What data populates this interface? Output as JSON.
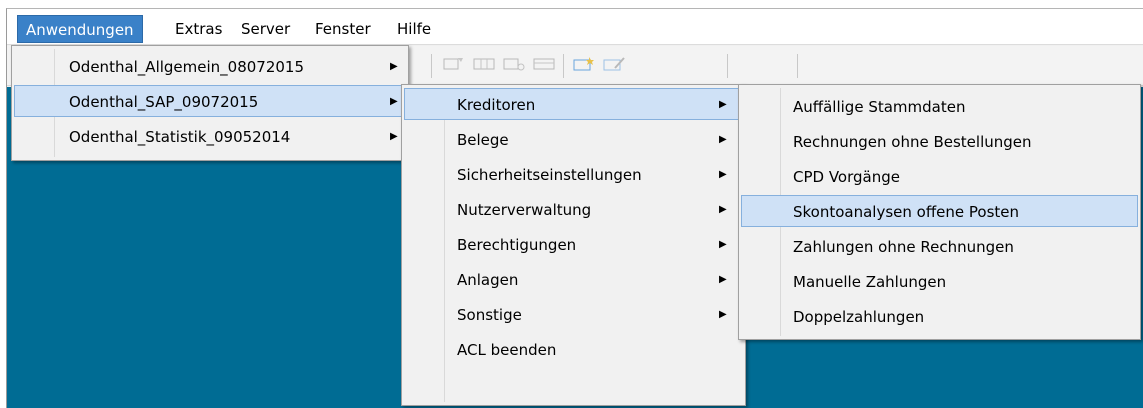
{
  "menubar": {
    "items": [
      {
        "label": "Anwendungen"
      },
      {
        "label": "Extras"
      },
      {
        "label": "Server"
      },
      {
        "label": "Fenster"
      },
      {
        "label": "Hilfe"
      }
    ]
  },
  "applications_menu": {
    "items": [
      {
        "label": "Odenthal_Allgemein_08072015",
        "submenu_arrow": "▶"
      },
      {
        "label": "Odenthal_SAP_09072015",
        "submenu_arrow": "▶"
      },
      {
        "label": "Odenthal_Statistik_09052014",
        "submenu_arrow": "▶"
      }
    ]
  },
  "sap_menu": {
    "items": [
      {
        "label": "Kreditoren",
        "submenu_arrow": "▶"
      },
      {
        "label": "Belege",
        "submenu_arrow": "▶"
      },
      {
        "label": "Sicherheitseinstellungen",
        "submenu_arrow": "▶"
      },
      {
        "label": "Nutzerverwaltung",
        "submenu_arrow": "▶"
      },
      {
        "label": "Berechtigungen",
        "submenu_arrow": "▶"
      },
      {
        "label": "Anlagen",
        "submenu_arrow": "▶"
      },
      {
        "label": "Sonstige",
        "submenu_arrow": "▶"
      },
      {
        "label": "ACL beenden"
      }
    ]
  },
  "kreditoren_menu": {
    "items": [
      {
        "label": "Auffällige Stammdaten"
      },
      {
        "label": "Rechnungen ohne Bestellungen"
      },
      {
        "label": "CPD Vorgänge"
      },
      {
        "label": "Skontoanalysen offene Posten"
      },
      {
        "label": "Zahlungen ohne Rechnungen"
      },
      {
        "label": "Manuelle Zahlungen"
      },
      {
        "label": "Doppelzahlungen"
      }
    ]
  },
  "colors": {
    "workspace": "#006c94",
    "menu_highlight": "#cfe1f6",
    "menubar_active": "#3a81c8"
  }
}
